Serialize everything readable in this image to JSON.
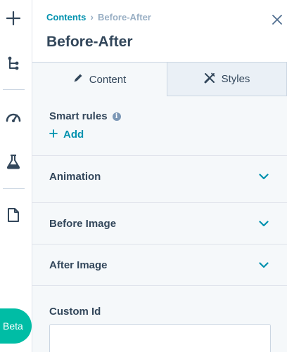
{
  "breadcrumb": {
    "parent": "Contents",
    "separator": "›",
    "current": "Before-After"
  },
  "panel": {
    "title": "Before-After"
  },
  "tabs": [
    {
      "label": "Content",
      "icon": "pencil-icon",
      "active": true
    },
    {
      "label": "Styles",
      "icon": "styles-icon",
      "active": false
    }
  ],
  "smart_rules": {
    "label": "Smart rules",
    "info": "i",
    "add_label": "Add"
  },
  "sections": [
    {
      "label": "Animation"
    },
    {
      "label": "Before Image"
    },
    {
      "label": "After Image"
    }
  ],
  "custom_id": {
    "label": "Custom Id",
    "value": ""
  },
  "rail": {
    "icons": [
      "plus-icon",
      "tree-icon",
      "gauge-icon",
      "flask-icon",
      "file-icon"
    ]
  },
  "beta_label": "Beta",
  "colors": {
    "accent": "#0091ae",
    "text": "#33475b",
    "muted": "#99afc4",
    "beta": "#00bda5",
    "panel_bg": "#f5f8fa"
  }
}
